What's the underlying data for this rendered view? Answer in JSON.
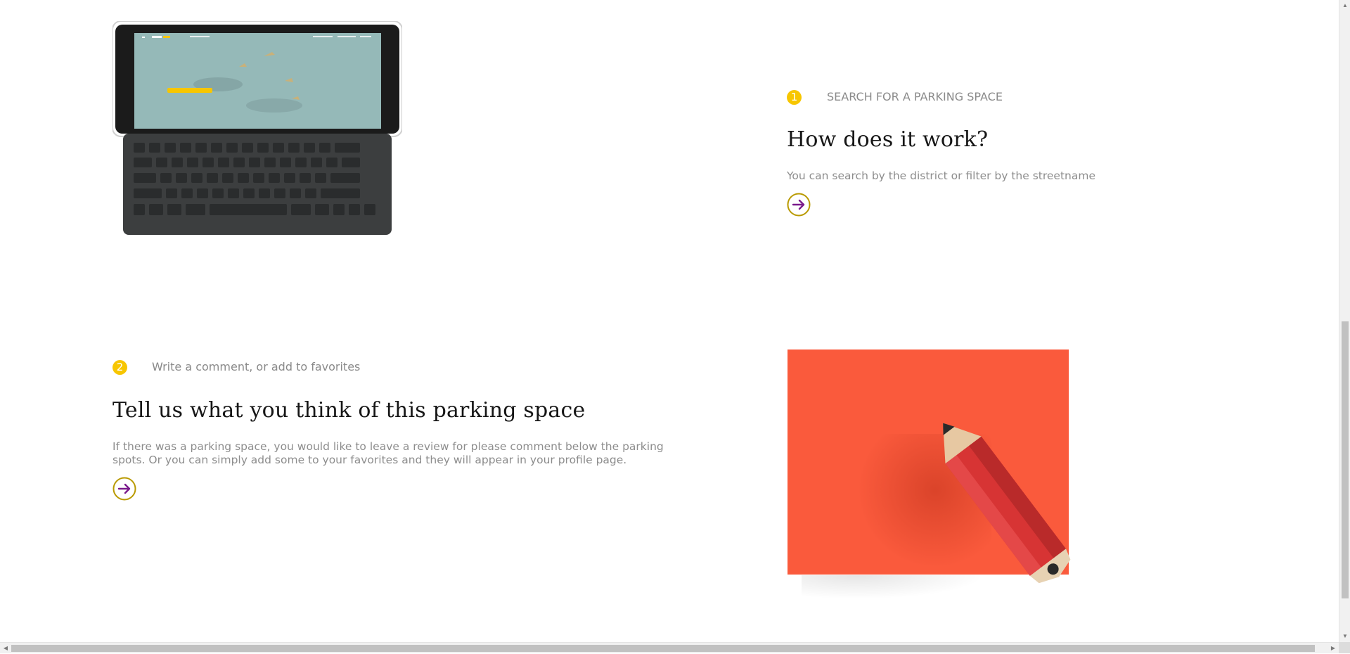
{
  "section1": {
    "step_number": "1",
    "step_label": "SEARCH FOR A PARKING SPACE",
    "title": "How does it work?",
    "description": "You can search by the district or filter by the streetname"
  },
  "section2": {
    "step_number": "2",
    "step_label": "Write a comment, or add to favorites",
    "title": "Tell us what you think of this parking space",
    "description_line1": "If there was a parking space, you would like to leave a review for please comment below the parking",
    "description_line2": "spots. Or you can simply add some to your favorites and they will appear in your profile page."
  },
  "colors": {
    "badge": "#f7c600",
    "arrow_button_ring": "#b99a00",
    "arrow_icon": "#7a1a8c",
    "orange_card": "#fa5a3c",
    "pencil_body": "#e23b3b"
  },
  "icons": [
    "arrow-right-circle-icon",
    "tablet-keyboard-image",
    "pencil-image"
  ],
  "scrollbars": {
    "vertical": "scroll",
    "horizontal": "scroll"
  }
}
